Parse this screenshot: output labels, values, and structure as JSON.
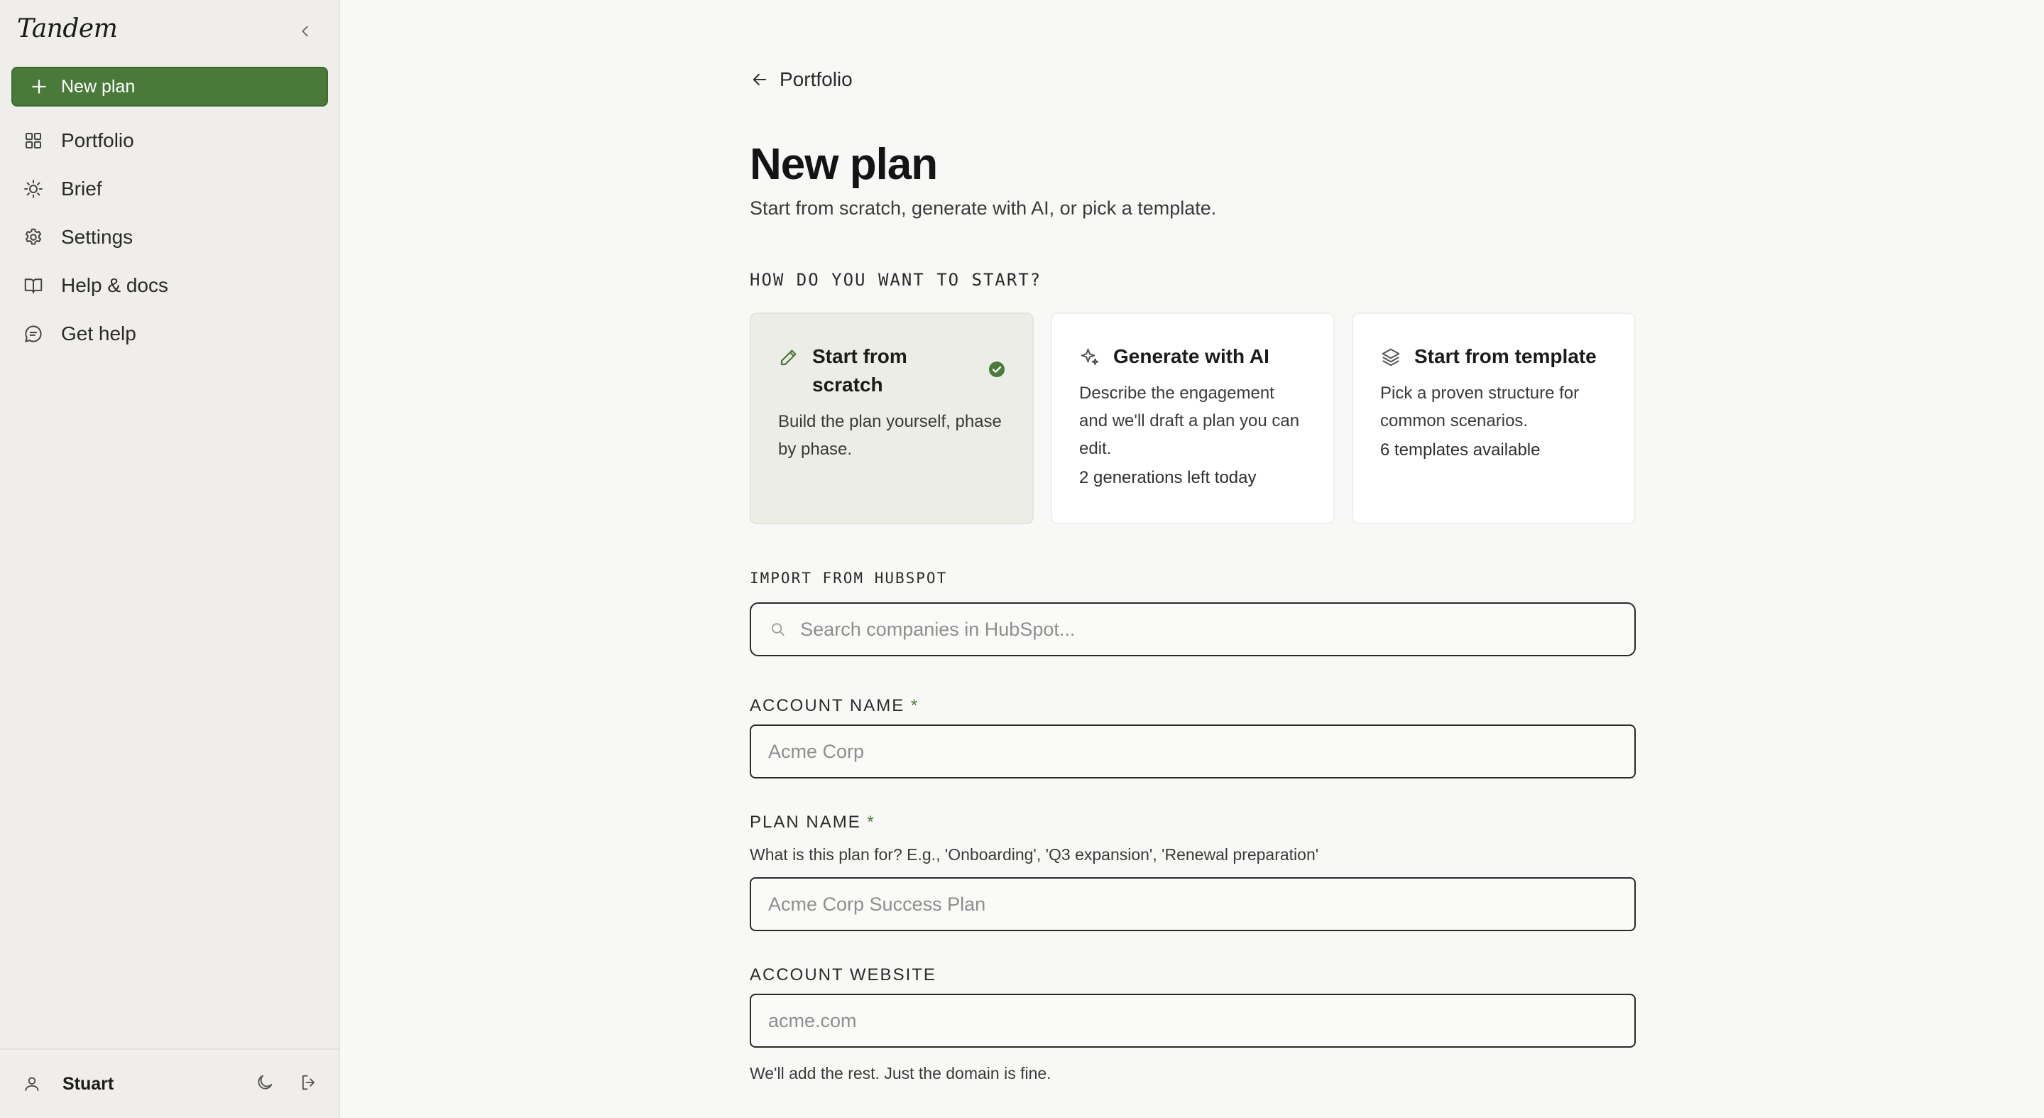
{
  "sidebar": {
    "brand": "Tandem",
    "new_plan_label": "New plan",
    "items": [
      {
        "label": "Portfolio",
        "icon": "grid-icon"
      },
      {
        "label": "Brief",
        "icon": "sun-icon"
      },
      {
        "label": "Settings",
        "icon": "gear-icon"
      },
      {
        "label": "Help & docs",
        "icon": "book-icon"
      },
      {
        "label": "Get help",
        "icon": "chat-icon"
      }
    ],
    "user": "Stuart"
  },
  "main": {
    "back_label": "Portfolio",
    "title": "New plan",
    "subtitle": "Start from scratch, generate with AI, or pick a template.",
    "start_label": "HOW DO YOU WANT TO START?",
    "cards": [
      {
        "title": "Start from scratch",
        "desc": "Build the plan yourself, phase by phase.",
        "meta": "",
        "selected": true
      },
      {
        "title": "Generate with AI",
        "desc": "Describe the engagement and we'll draft a plan you can edit.",
        "meta": "2 generations left today",
        "selected": false
      },
      {
        "title": "Start from template",
        "desc": "Pick a proven structure for common scenarios.",
        "meta": "6 templates available",
        "selected": false
      }
    ],
    "import_label": "IMPORT FROM HUBSPOT",
    "search_placeholder": "Search companies in HubSpot...",
    "account_name": {
      "label": "ACCOUNT NAME",
      "required_mark": "*",
      "placeholder": "Acme Corp",
      "value": ""
    },
    "plan_name": {
      "label": "PLAN NAME",
      "required_mark": "*",
      "help": "What is this plan for? E.g., 'Onboarding', 'Q3 expansion', 'Renewal preparation'",
      "placeholder": "Acme Corp Success Plan",
      "value": ""
    },
    "account_website": {
      "label": "ACCOUNT WEBSITE",
      "placeholder": "acme.com",
      "value": "",
      "help": "We'll add the rest. Just the domain is fine."
    }
  },
  "colors": {
    "accent": "#4a7a3a",
    "sidebar_bg": "#efeeeb",
    "page_bg": "#f8f8f6",
    "selected_card_bg": "#ebede6"
  }
}
